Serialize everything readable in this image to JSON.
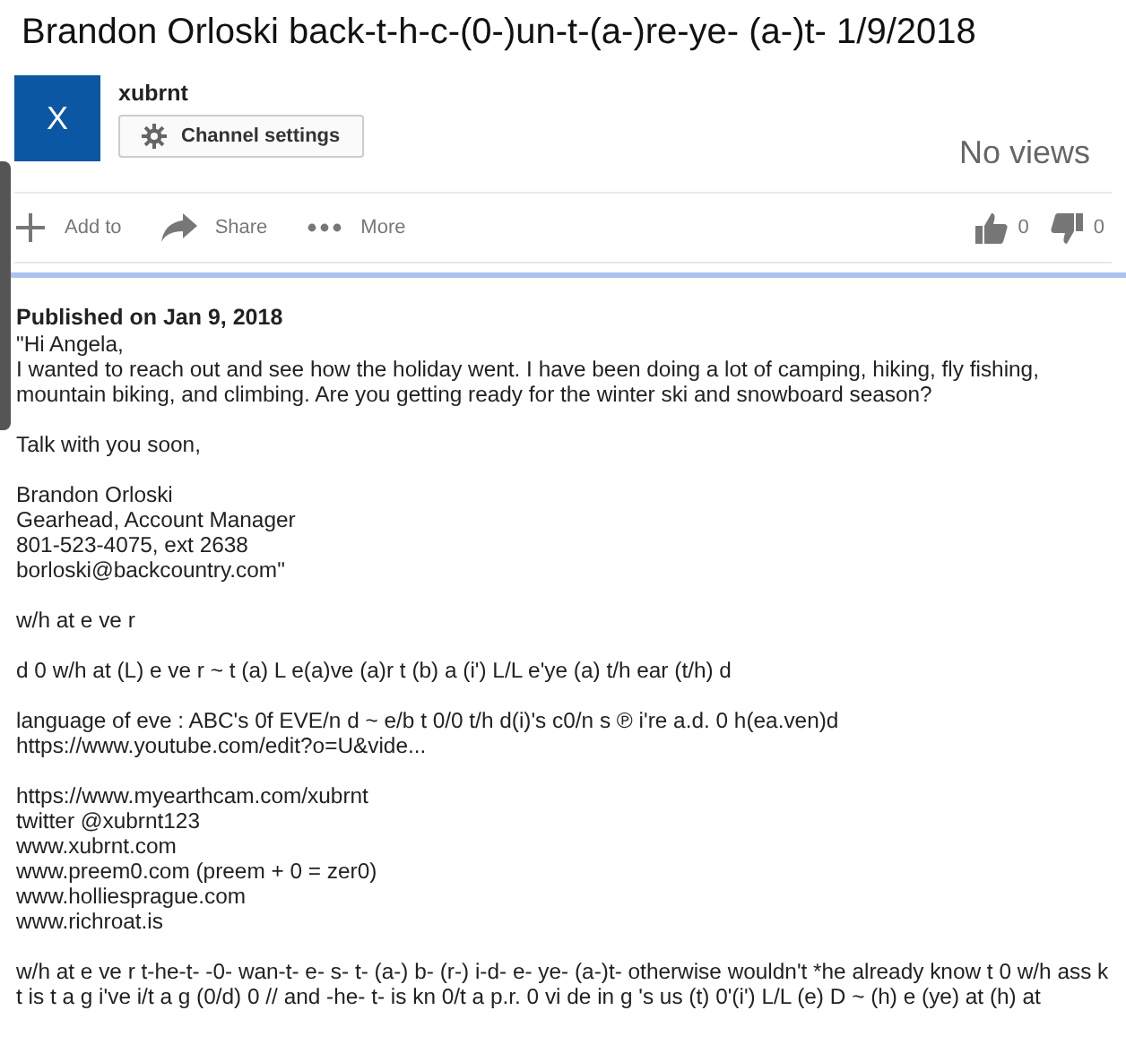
{
  "title": "Brandon Orloski back-t-h-c-(0-)un-t-(a-)re-ye- (a-)t- 1/9/2018",
  "channel": {
    "avatar_letter": "X",
    "name": "xubrnt",
    "settings_button": "Channel settings"
  },
  "views": "No views",
  "actions": [
    {
      "kind": "add",
      "label": "Add to"
    },
    {
      "kind": "share",
      "label": "Share"
    },
    {
      "kind": "more",
      "label": "More"
    }
  ],
  "likes": "0",
  "dislikes": "0",
  "published": "Published on Jan 9, 2018",
  "description": [
    "\"Hi Angela,\nI wanted to reach out and see how the holiday went. I have been doing a lot of camping, hiking, fly fishing, mountain biking, and climbing. Are you getting ready for the winter ski and snowboard season?",
    "Talk with you soon,",
    "Brandon Orloski\nGearhead, Account Manager\n801-523-4075, ext 2638\nborloski@backcountry.com\"",
    "w/h at e ve r",
    "d 0 w/h at (L) e ve r ~ t (a) L e(a)ve (a)r t (b) a (i') L/L e'ye (a) t/h ear (t/h) d",
    "language of eve : ABC's 0f EVE/n d ~ e/b t 0/0 t/h d(i)'s c0/n s ℗ i're a.d. 0 h(ea.ven)d\nhttps://www.youtube.com/edit?o=U&vide...",
    "https://www.myearthcam.com/xubrnt\ntwitter @xubrnt123\nwww.xubrnt.com\nwww.preem0.com (preem + 0 = zer0)\nwww.holliesprague.com\nwww.richroat.is",
    "w/h at e ve r t-he-t- -0- wan-t- e- s- t- (a-) b- (r-) i-d- e- ye- (a-)t- otherwise wouldn't *he already know t 0 w/h ass k t is t a g i've i/t a g (0/d) 0 // and -he- t- is kn 0/t a p.r. 0 vi de in g 's us (t) 0'(i') L/L (e) D ~ (h) e (ye) at (h) at"
  ]
}
